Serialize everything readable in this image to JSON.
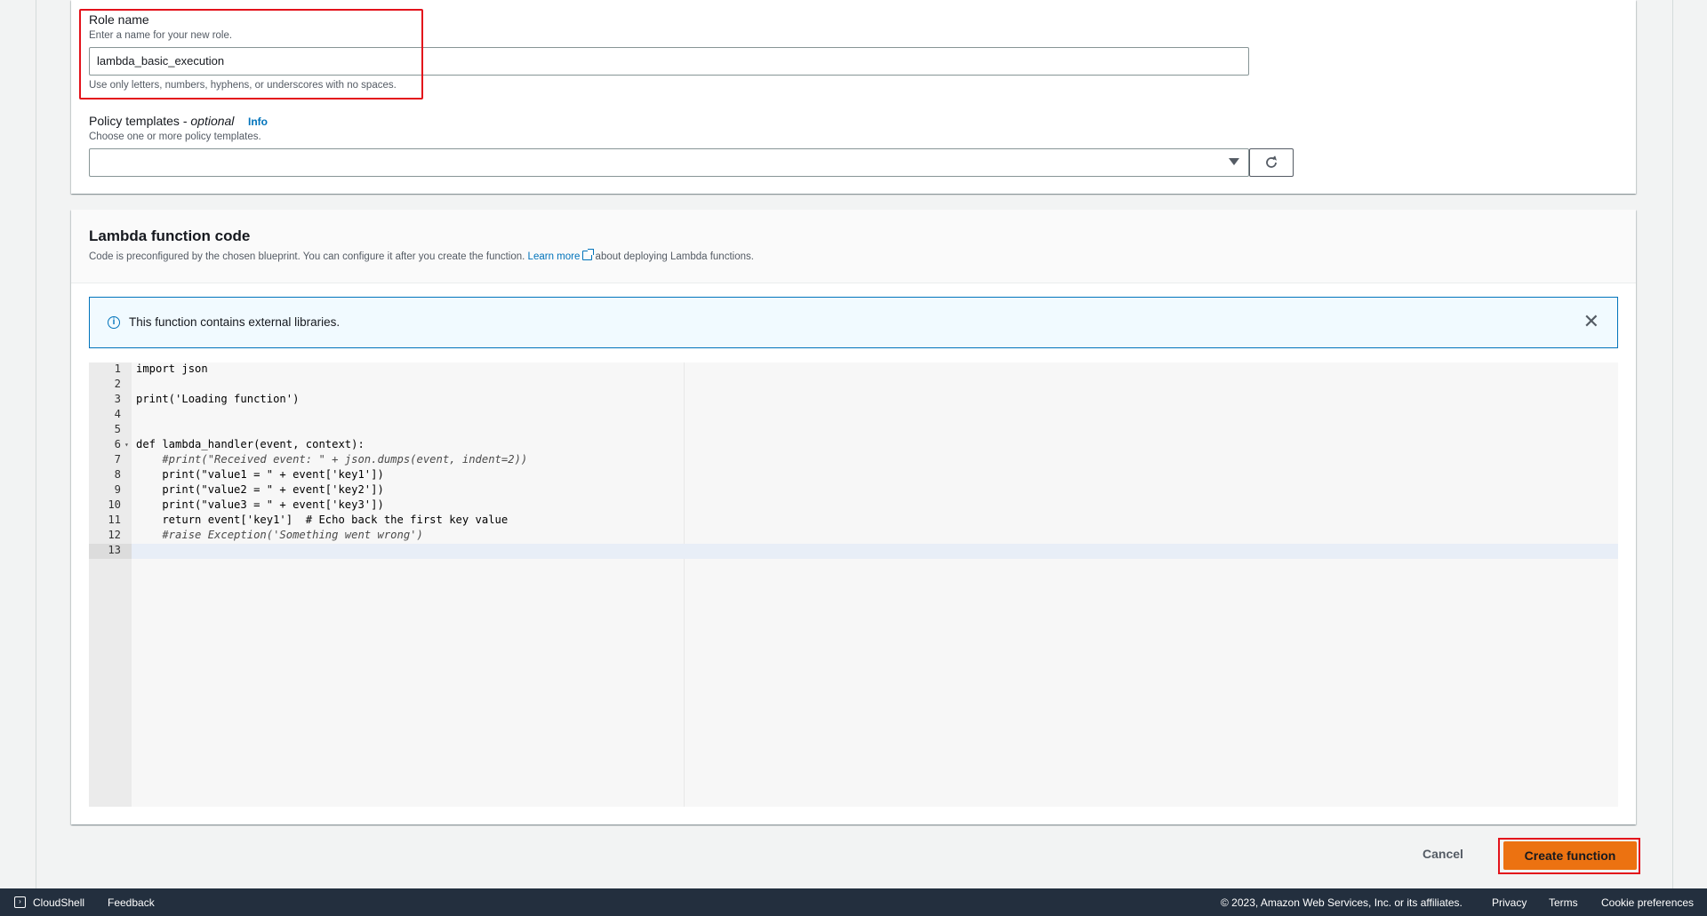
{
  "role": {
    "label": "Role name",
    "description": "Enter a name for your new role.",
    "value": "lambda_basic_execution",
    "constraint": "Use only letters, numbers, hyphens, or underscores with no spaces."
  },
  "policy_templates": {
    "label": "Policy templates - ",
    "optional": "optional",
    "info": "Info",
    "description": "Choose one or more policy templates.",
    "selected": ""
  },
  "code_section": {
    "title": "Lambda function code",
    "desc_before": "Code is preconfigured by the chosen blueprint. You can configure it after you create the function. ",
    "learn_more": "Learn more",
    "desc_after": " about deploying Lambda functions."
  },
  "alert": {
    "text": "This function contains external libraries."
  },
  "editor": {
    "line_numbers": [
      "1",
      "2",
      "3",
      "4",
      "5",
      "6",
      "7",
      "8",
      "9",
      "10",
      "11",
      "12",
      "13"
    ],
    "lines": [
      "import json",
      "",
      "print('Loading function')",
      "",
      "",
      "def lambda_handler(event, context):",
      "    #print(\"Received event: \" + json.dumps(event, indent=2))",
      "    print(\"value1 = \" + event['key1'])",
      "    print(\"value2 = \" + event['key2'])",
      "    print(\"value3 = \" + event['key3'])",
      "    return event['key1']  # Echo back the first key value",
      "    #raise Exception('Something went wrong')",
      ""
    ]
  },
  "actions": {
    "cancel": "Cancel",
    "create": "Create function"
  },
  "footer": {
    "cloudshell": "CloudShell",
    "feedback": "Feedback",
    "copyright": "© 2023, Amazon Web Services, Inc. or its affiliates.",
    "privacy": "Privacy",
    "terms": "Terms",
    "cookies": "Cookie preferences"
  },
  "colors": {
    "primary_button": "#ec7211",
    "link": "#0073bb",
    "highlight": "#e3121b",
    "footer_bg": "#232f3e"
  }
}
